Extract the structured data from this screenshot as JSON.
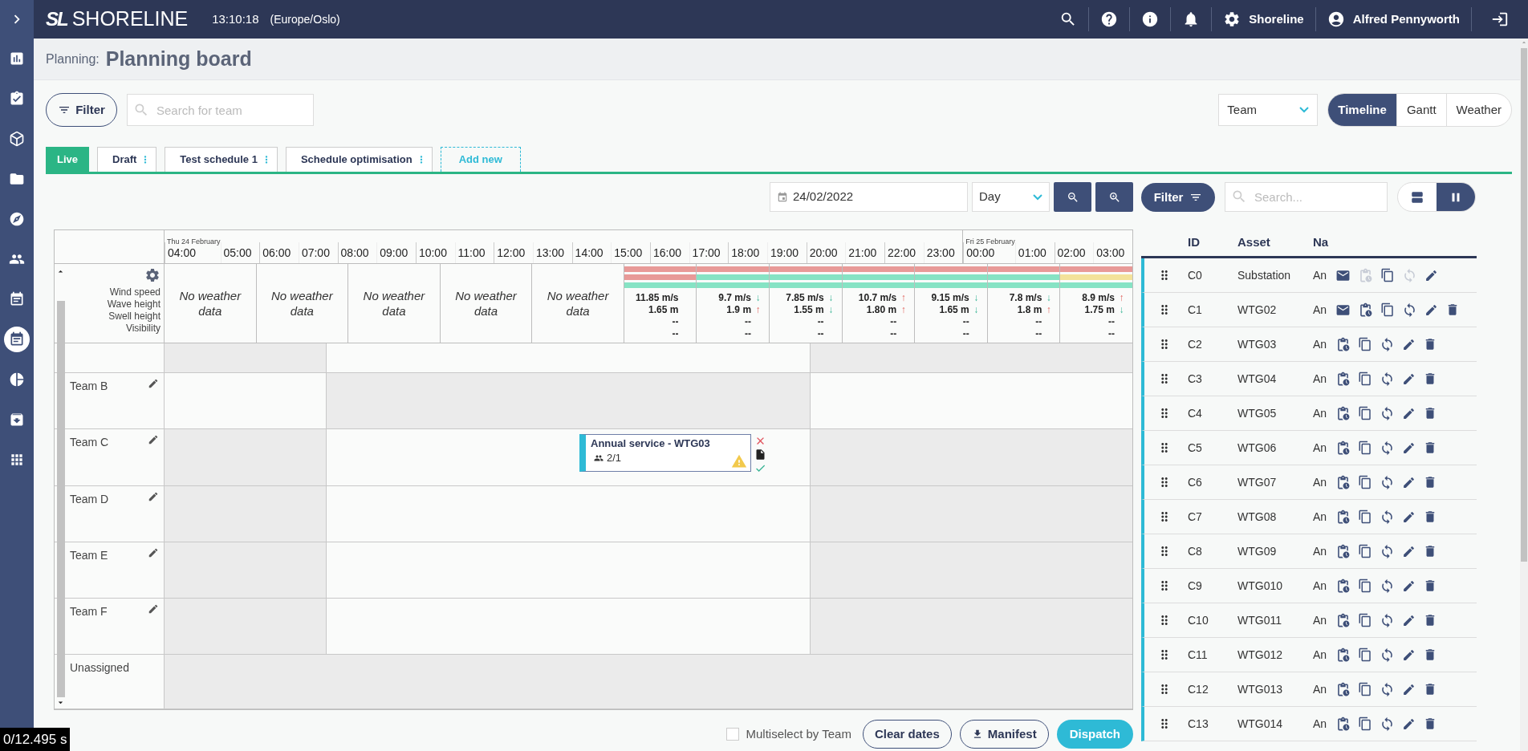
{
  "sidebar": {
    "items": [
      {
        "selected": false
      },
      {
        "selected": false
      },
      {
        "selected": false
      },
      {
        "selected": false
      },
      {
        "selected": false
      },
      {
        "selected": false
      },
      {
        "selected": false
      },
      {
        "selected": true
      },
      {
        "selected": false
      },
      {
        "selected": false
      },
      {
        "selected": false
      }
    ]
  },
  "topbar": {
    "logo_mark": "SL",
    "logo_text": "SHORELINE",
    "clock": "13:10:18",
    "timezone": "(Europe/Oslo)",
    "org": "Shoreline",
    "user": "Alfred Pennyworth"
  },
  "header": {
    "section": "Planning:",
    "title": "Planning board"
  },
  "toolbar": {
    "filter": "Filter",
    "search_placeholder": "Search for team",
    "group_by": "Team",
    "views": [
      {
        "label": "Timeline",
        "selected": true
      },
      {
        "label": "Gantt",
        "selected": false
      },
      {
        "label": "Weather",
        "selected": false
      }
    ]
  },
  "tabs": [
    {
      "kind": "schedule",
      "label": "Live",
      "selected": true,
      "menu": false
    },
    {
      "kind": "schedule",
      "label": "Draft",
      "selected": false,
      "menu": true
    },
    {
      "kind": "schedule",
      "label": "Test schedule 1",
      "selected": false,
      "menu": true
    },
    {
      "kind": "schedule",
      "label": "Schedule optimisation",
      "selected": false,
      "menu": true
    },
    {
      "kind": "add",
      "label": "Add new"
    }
  ],
  "board": {
    "date": "24/02/2022",
    "range": "Day",
    "hours": [
      {
        "label": "04:00",
        "day": "Thu 24 February"
      },
      {
        "label": "05:00"
      },
      {
        "label": "06:00"
      },
      {
        "label": "07:00"
      },
      {
        "label": "08:00"
      },
      {
        "label": "09:00"
      },
      {
        "label": "10:00"
      },
      {
        "label": "11:00"
      },
      {
        "label": "12:00"
      },
      {
        "label": "13:00"
      },
      {
        "label": "14:00"
      },
      {
        "label": "15:00"
      },
      {
        "label": "16:00"
      },
      {
        "label": "17:00"
      },
      {
        "label": "18:00"
      },
      {
        "label": "19:00"
      },
      {
        "label": "20:00"
      },
      {
        "label": "21:00"
      },
      {
        "label": "22:00"
      },
      {
        "label": "23:00"
      },
      {
        "label": "00:00",
        "day": "Fri 25 February"
      },
      {
        "label": "01:00"
      },
      {
        "label": "02:00"
      },
      {
        "label": "03:00"
      }
    ],
    "weather_labels": [
      "Wind speed",
      "Wave height",
      "Swell height",
      "Visibility"
    ],
    "weather": [
      {
        "kind": "none",
        "text": "No weather data"
      },
      {
        "kind": "none",
        "text": "No weather data"
      },
      {
        "kind": "none",
        "text": "No weather data"
      },
      {
        "kind": "none",
        "text": "No weather data"
      },
      {
        "kind": "none",
        "text": "No weather data"
      },
      {
        "kind": "data",
        "bars": [
          {
            "color": "#e89a98"
          },
          {
            "color": "#e89a98"
          },
          {
            "color": "#86e3c4"
          }
        ],
        "wind": {
          "value": "11.85 m/s"
        },
        "wave": {
          "value": "1.65 m"
        },
        "swell": "--",
        "visibility": "--"
      },
      {
        "kind": "data",
        "bars": [
          {
            "color": "#e89a98"
          },
          {
            "color": "#86e3c4"
          },
          {
            "color": "#86e3c4"
          }
        ],
        "wind": {
          "value": "9.7 m/s",
          "arrow": "↓",
          "rising": false
        },
        "wave": {
          "value": "1.9 m",
          "arrow": "↑",
          "rising": true
        },
        "swell": "--",
        "visibility": "--"
      },
      {
        "kind": "data",
        "bars": [
          {
            "color": "#e89a98"
          },
          {
            "color": "#86e3c4"
          },
          {
            "color": "#86e3c4"
          }
        ],
        "wind": {
          "value": "7.85 m/s",
          "arrow": "↓",
          "rising": false
        },
        "wave": {
          "value": "1.55 m",
          "arrow": "↓",
          "rising": false
        },
        "swell": "--",
        "visibility": "--"
      },
      {
        "kind": "data",
        "bars": [
          {
            "color": "#e89a98"
          },
          {
            "color": "#86e3c4"
          },
          {
            "color": "#86e3c4"
          }
        ],
        "wind": {
          "value": "10.7 m/s",
          "arrow": "↑",
          "rising": true
        },
        "wave": {
          "value": "1.80 m",
          "arrow": "↑",
          "rising": true
        },
        "swell": "--",
        "visibility": "--"
      },
      {
        "kind": "data",
        "bars": [
          {
            "color": "#e89a98"
          },
          {
            "color": "#86e3c4"
          },
          {
            "color": "#86e3c4"
          }
        ],
        "wind": {
          "value": "9.15 m/s",
          "arrow": "↓",
          "rising": false
        },
        "wave": {
          "value": "1.65 m",
          "arrow": "↓",
          "rising": false
        },
        "swell": "--",
        "visibility": "--"
      },
      {
        "kind": "data",
        "bars": [
          {
            "color": "#e89a98"
          },
          {
            "color": "#86e3c4"
          },
          {
            "color": "#86e3c4"
          }
        ],
        "wind": {
          "value": "7.8 m/s",
          "arrow": "↓",
          "rising": false
        },
        "wave": {
          "value": "1.8 m",
          "arrow": "↑",
          "rising": true
        },
        "swell": "--",
        "visibility": "--"
      },
      {
        "kind": "data",
        "bars": [
          {
            "color": "#e89a98"
          },
          {
            "color": "#f3e29a"
          },
          {
            "color": "#86e3c4"
          }
        ],
        "wind": {
          "value": "8.9 m/s",
          "arrow": "↑",
          "rising": true
        },
        "wave": {
          "value": "1.75 m",
          "arrow": "↓",
          "rising": false
        },
        "swell": "--",
        "visibility": "--"
      }
    ],
    "rows": [
      {
        "editable": false,
        "segments": [
          {
            "available": false
          },
          {
            "available": true
          },
          {
            "available": false
          }
        ]
      },
      {
        "label": "Team B",
        "editable": true,
        "segments": [
          {
            "available": true
          },
          {
            "available": false
          },
          {
            "available": true
          }
        ]
      },
      {
        "label": "Team C",
        "editable": true,
        "segments": [
          {
            "available": false
          },
          {
            "available": true
          },
          {
            "available": false
          }
        ],
        "events": [
          {
            "title": "Annual service - WTG03",
            "crew": "2/1",
            "warning": true
          }
        ]
      },
      {
        "label": "Team D",
        "editable": true,
        "segments": [
          {
            "available": false
          },
          {
            "available": true
          },
          {
            "available": false
          }
        ]
      },
      {
        "label": "Team E",
        "editable": true,
        "segments": [
          {
            "available": false
          },
          {
            "available": true
          },
          {
            "available": false
          }
        ]
      },
      {
        "label": "Team F",
        "editable": true,
        "segments": [
          {
            "available": false
          },
          {
            "available": true
          },
          {
            "available": false
          }
        ]
      },
      {
        "label": "Unassigned",
        "editable": false,
        "segments": [
          {
            "available": false
          }
        ]
      }
    ]
  },
  "footer": {
    "multiselect": {
      "label": "Multiselect by Team",
      "checked": false
    },
    "buttons": [
      {
        "kind": "outline",
        "label": "Clear dates"
      },
      {
        "kind": "download",
        "label": "Manifest"
      },
      {
        "kind": "primary",
        "label": "Dispatch"
      }
    ]
  },
  "assets": {
    "filter": "Filter",
    "search_placeholder": "Search...",
    "layouts": [
      {
        "selected": false
      },
      {
        "selected": true
      }
    ],
    "columns": [
      "ID",
      "Asset",
      "Na"
    ],
    "rows": [
      {
        "id": "C0",
        "asset": "Substation",
        "name": "An",
        "mail": true,
        "locked": true
      },
      {
        "id": "C1",
        "asset": "WTG02",
        "name": "An",
        "mail": true,
        "locked": false
      },
      {
        "id": "C2",
        "asset": "WTG03",
        "name": "An",
        "mail": false,
        "locked": false
      },
      {
        "id": "C3",
        "asset": "WTG04",
        "name": "An",
        "mail": false,
        "locked": false
      },
      {
        "id": "C4",
        "asset": "WTG05",
        "name": "An",
        "mail": false,
        "locked": false
      },
      {
        "id": "C5",
        "asset": "WTG06",
        "name": "An",
        "mail": false,
        "locked": false
      },
      {
        "id": "C6",
        "asset": "WTG07",
        "name": "An",
        "mail": false,
        "locked": false
      },
      {
        "id": "C7",
        "asset": "WTG08",
        "name": "An",
        "mail": false,
        "locked": false
      },
      {
        "id": "C8",
        "asset": "WTG09",
        "name": "An",
        "mail": false,
        "locked": false
      },
      {
        "id": "C9",
        "asset": "WTG010",
        "name": "An",
        "mail": false,
        "locked": false
      },
      {
        "id": "C10",
        "asset": "WTG011",
        "name": "An",
        "mail": false,
        "locked": false
      },
      {
        "id": "C11",
        "asset": "WTG012",
        "name": "An",
        "mail": false,
        "locked": false
      },
      {
        "id": "C12",
        "asset": "WTG013",
        "name": "An",
        "mail": false,
        "locked": false
      },
      {
        "id": "C13",
        "asset": "WTG014",
        "name": "An",
        "mail": false,
        "locked": false
      }
    ]
  },
  "recording_overlay": "0/12.495 s"
}
